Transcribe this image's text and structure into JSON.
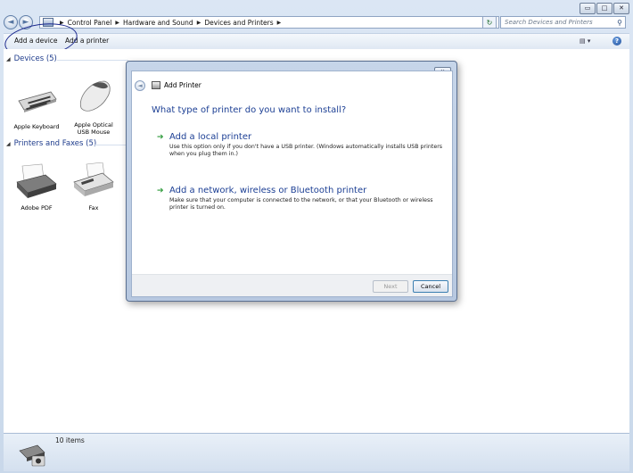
{
  "window": {
    "caption_buttons": [
      "minimize",
      "maximize",
      "close"
    ]
  },
  "address_bar": {
    "crumbs": [
      "Control Panel",
      "Hardware and Sound",
      "Devices and Printers"
    ],
    "search_placeholder": "Search Devices and Printers"
  },
  "toolbar": {
    "add_device": "Add a device",
    "add_printer": "Add a printer"
  },
  "groups": {
    "devices": {
      "title": "Devices (5)",
      "items": [
        {
          "label_line1": "Apple Keyboard",
          "label_line2": ""
        },
        {
          "label_line1": "Apple Optical",
          "label_line2": "USB Mouse"
        }
      ]
    },
    "printers": {
      "title": "Printers and Faxes (5)",
      "items": [
        {
          "label_line1": "Adobe PDF",
          "label_line2": ""
        },
        {
          "label_line1": "Fax",
          "label_line2": ""
        }
      ]
    }
  },
  "status_bar": {
    "count": "10 items"
  },
  "dialog": {
    "title": "Add Printer",
    "question": "What type of printer do you want to install?",
    "options": [
      {
        "title": "Add a local printer",
        "description": "Use this option only if you don't have a USB printer. (Windows automatically installs USB printers when you plug them in.)"
      },
      {
        "title": "Add a network, wireless or Bluetooth printer",
        "description": "Make sure that your computer is connected to the network, or that your Bluetooth or wireless printer is turned on."
      }
    ],
    "next_label": "Next",
    "cancel_label": "Cancel"
  },
  "colors": {
    "link_blue": "#1c3f94",
    "arrow_green": "#2d9a3a"
  }
}
